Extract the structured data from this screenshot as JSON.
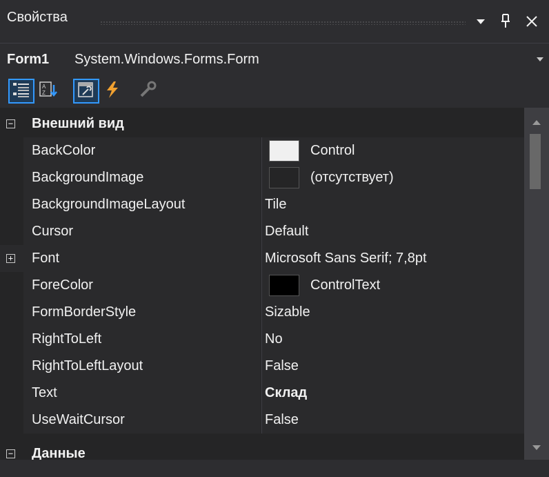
{
  "panel": {
    "title": "Свойства",
    "menu_icon": "dropdown-arrow-icon",
    "pin_icon": "pin-icon",
    "close_icon": "close-icon"
  },
  "object_selector": {
    "name": "Form1",
    "type": "System.Windows.Forms.Form"
  },
  "toolbar": {
    "buttons": [
      {
        "icon": "categorized-icon",
        "active": true
      },
      {
        "icon": "alphabetical-icon",
        "active": false
      },
      {
        "icon": "properties-icon",
        "active": true
      },
      {
        "icon": "events-icon",
        "active": false
      },
      {
        "icon": "property-pages-icon",
        "active": false
      }
    ]
  },
  "grid": {
    "category_appearance": "Внешний вид",
    "category_data": "Данные",
    "properties": [
      {
        "name": "BackColor",
        "value": "Control",
        "swatch": "#f0f0f0"
      },
      {
        "name": "BackgroundImage",
        "value": "(отсутствует)",
        "swatch": "#252526"
      },
      {
        "name": "BackgroundImageLayout",
        "value": "Tile"
      },
      {
        "name": "Cursor",
        "value": "Default"
      },
      {
        "name": "Font",
        "value": "Microsoft Sans Serif; 7,8pt",
        "expandable": true
      },
      {
        "name": "ForeColor",
        "value": "ControlText",
        "swatch": "#000000"
      },
      {
        "name": "FormBorderStyle",
        "value": "Sizable"
      },
      {
        "name": "RightToLeft",
        "value": "No"
      },
      {
        "name": "RightToLeftLayout",
        "value": "False"
      },
      {
        "name": "Text",
        "value": "Склад",
        "bold": true
      },
      {
        "name": "UseWaitCursor",
        "value": "False"
      }
    ]
  },
  "colors": {
    "background": "#252526",
    "chrome": "#2d2d30",
    "accent": "#3399ff",
    "text": "#f1f1f1"
  }
}
